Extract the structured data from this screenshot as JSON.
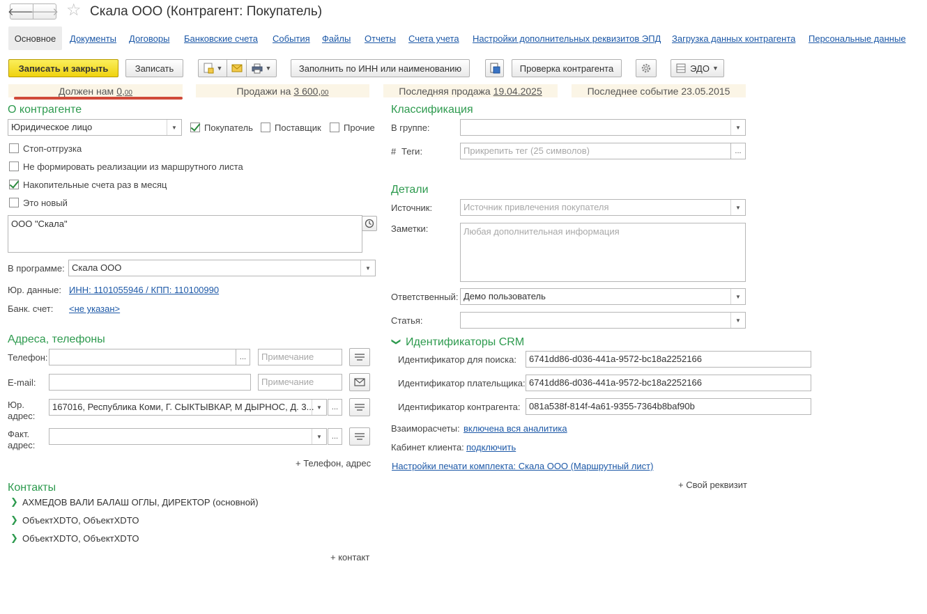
{
  "window": {
    "title": "Скала ООО (Контрагент: Покупатель)"
  },
  "tabs": [
    {
      "label": "Основное",
      "active": true
    },
    {
      "label": "Документы"
    },
    {
      "label": "Договоры"
    },
    {
      "label": "Банковские счета"
    },
    {
      "label": "События"
    },
    {
      "label": "Файлы"
    },
    {
      "label": "Отчеты"
    },
    {
      "label": "Счета учета"
    },
    {
      "label": "Настройки дополнительных реквизитов ЭПД"
    },
    {
      "label": "Загрузка данных контрагента"
    },
    {
      "label": "Персональные данные"
    }
  ],
  "toolbar": {
    "save_close": "Записать и закрыть",
    "save": "Записать",
    "fill_by_inn": "Заполнить по ИНН или наименованию",
    "check_counterparty": "Проверка контрагента",
    "edo": "ЭДО"
  },
  "info": {
    "owes_label": "Должен нам",
    "owes_value": "0,",
    "owes_cents": "00",
    "sales_label": "Продажи на",
    "sales_value": "3 600,",
    "sales_cents": "00",
    "last_sale_label": "Последняя продажа",
    "last_sale_value": "19.04.2025",
    "last_event": "Последнее событие 23.05.2015"
  },
  "about": {
    "section": "О контрагенте",
    "legal_type": "Юридическое лицо",
    "buyer": "Покупатель",
    "supplier": "Поставщик",
    "other": "Прочие",
    "stop_shipping": "Стоп-отгрузка",
    "no_route_sales": "Не формировать реализации из маршрутного листа",
    "monthly_invoices": "Накопительные счета раз в месяц",
    "is_new": "Это новый",
    "full_name": "ООО \"Скала\"",
    "in_program_label": "В программе:",
    "in_program_value": "Скала ООО",
    "legal_data_label": "Юр. данные:",
    "legal_data_value": "ИНН: 1101055946 / КПП: 110100990",
    "bank_label": "Банк. счет:",
    "bank_value": "<не указан>"
  },
  "addresses": {
    "section": "Адреса, телефоны",
    "phone_label": "Телефон:",
    "email_label": "E-mail:",
    "legal_addr_label_1": "Юр.",
    "legal_addr_label_2": "адрес:",
    "legal_addr_value": "167016, Республика Коми, Г. СЫКТЫВКАР, М ДЫРНОС, Д. 3...",
    "fact_addr_label_1": "Факт.",
    "fact_addr_label_2": "адрес:",
    "note_placeholder": "Примечание",
    "dots": "...",
    "add_phone": "+ Телефон, адрес"
  },
  "contacts": {
    "section": "Контакты",
    "items": [
      "АХМЕДОВ ВАЛИ БАЛАШ ОГЛЫ, ДИРЕКТОР (основной)",
      "ОбъектXDTO, ОбъектXDTO",
      "ОбъектXDTO, ОбъектXDTO"
    ],
    "add": "+ контакт"
  },
  "classification": {
    "section": "Классификация",
    "group_label": "В группе:",
    "tags_label": "Теги:",
    "tags_hash": "#",
    "tags_placeholder": "Прикрепить тег (25 символов)"
  },
  "details": {
    "section": "Детали",
    "source_label": "Источник:",
    "source_placeholder": "Источник привлечения покупателя",
    "notes_label": "Заметки:",
    "notes_placeholder": "Любая дополнительная информация",
    "responsible_label": "Ответственный:",
    "responsible_value": "Демо пользователь",
    "article_label": "Статья:"
  },
  "crm": {
    "section": "Идентификаторы CRM",
    "search_label": "Идентификатор для поиска:",
    "search_value": "6741dd86-d036-441a-9572-bc18a2252166",
    "payer_label": "Идентификатор плательщика:",
    "payer_value": "6741dd86-d036-441a-9572-bc18a2252166",
    "counterparty_label": "Идентификатор контрагента:",
    "counterparty_value": "081a538f-814f-4a61-9355-7364b8baf90b"
  },
  "extra": {
    "settlements_label": "Взаиморасчеты:",
    "settlements_value": "включена вся аналитика",
    "cabinet_label": "Кабинет клиента:",
    "cabinet_value": "подключить",
    "print_settings": "Настройки печати комплекта: Скала ООО (Маршрутный лист)",
    "add_attr": "+ Свой реквизит"
  },
  "icons": {
    "back": "arrow-left-icon",
    "forward": "arrow-right-icon",
    "favorite": "star-icon",
    "create_based": "document-create-icon",
    "mail": "envelope-icon",
    "print": "printer-icon",
    "scan": "scanner-icon",
    "settings": "gear-icon",
    "edo": "edo-stack-icon",
    "history": "history-icon",
    "phone_list": "list-icon",
    "email_send": "envelope-icon",
    "dropdown": "chevron-down-icon",
    "expand": "chevron-right-icon"
  },
  "colors": {
    "accent_green": "#2d9a4e",
    "link_blue": "#1c58a7",
    "primary_yellow": "#f5e033",
    "info_bg": "#fbf5e6",
    "annotation_red": "#d04a3a"
  }
}
